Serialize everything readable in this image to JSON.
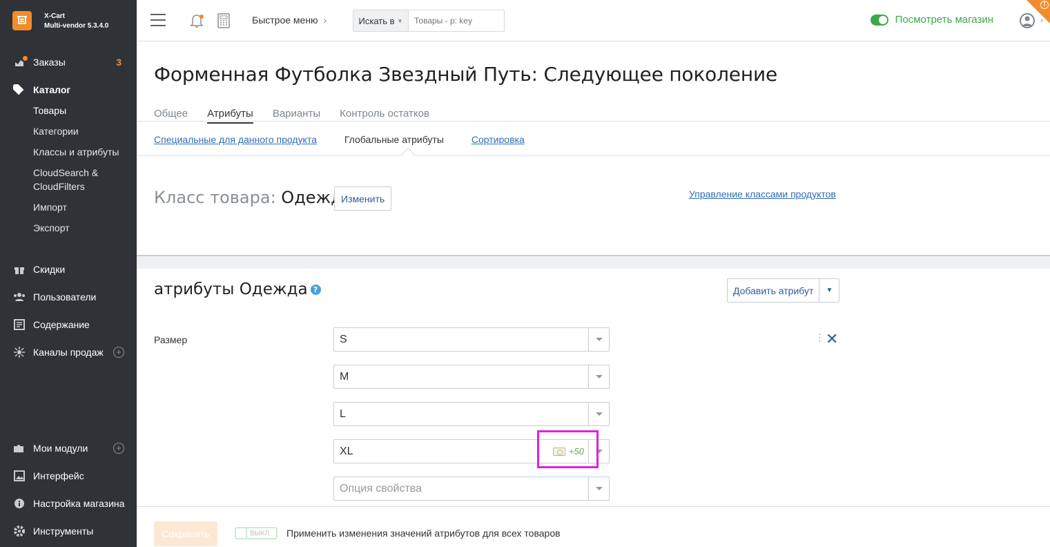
{
  "app": {
    "name": "X-Cart",
    "version": "Multi-vendor 5.3.4.0"
  },
  "sidebar": {
    "orders_label": "Заказы",
    "orders_count": "3",
    "catalog_label": "Каталог",
    "catalog_items": [
      "Товары",
      "Категории",
      "Классы и атрибуты",
      "CloudSearch &",
      "CloudFilters",
      "Импорт",
      "Экспорт"
    ],
    "discounts_label": "Скидки",
    "users_label": "Пользователи",
    "content_label": "Содержание",
    "channels_label": "Каналы продаж",
    "modules_label": "Мои модули",
    "interface_label": "Интерфейс",
    "store_settings_label": "Настройка магазина",
    "tools_label": "Инструменты"
  },
  "header": {
    "quick_menu": "Быстрое меню",
    "search_in": "Искать в",
    "search_placeholder": "Товары - р: key",
    "view_store": "Посмотреть магазин"
  },
  "page": {
    "title": "Форменная Футболка Звездный Путь: Следующее поколение",
    "tabs": [
      "Общее",
      "Атрибуты",
      "Варианты",
      "Контроль остатков"
    ],
    "subtabs": {
      "specific": "Специальные для данного продукта",
      "global": "Глобальные атрибуты",
      "sorting": "Сортировка"
    },
    "class_label": "Класс товара:",
    "class_value": "Одежда",
    "change_button": "Изменить",
    "manage_classes": "Управление классами продуктов",
    "attributes_title": "атрибуты Одежда",
    "add_attribute": "Добавить атрибут",
    "attribute_name": "Размер",
    "options": [
      "S",
      "M",
      "L",
      "XL"
    ],
    "xl_modifier": "+50",
    "option_placeholder": "Опция свойства"
  },
  "footer": {
    "save": "Сохранить",
    "toggle_state": "ВЫКЛ",
    "apply_label": "Применить изменения значений атрибутов для всех товаров"
  },
  "colors": {
    "sidebar_bg": "#2f3338",
    "accent_orange": "#f28c2a",
    "link_blue": "#2f6db3",
    "store_green": "#3fa748",
    "highlight_magenta": "#e020e0"
  }
}
